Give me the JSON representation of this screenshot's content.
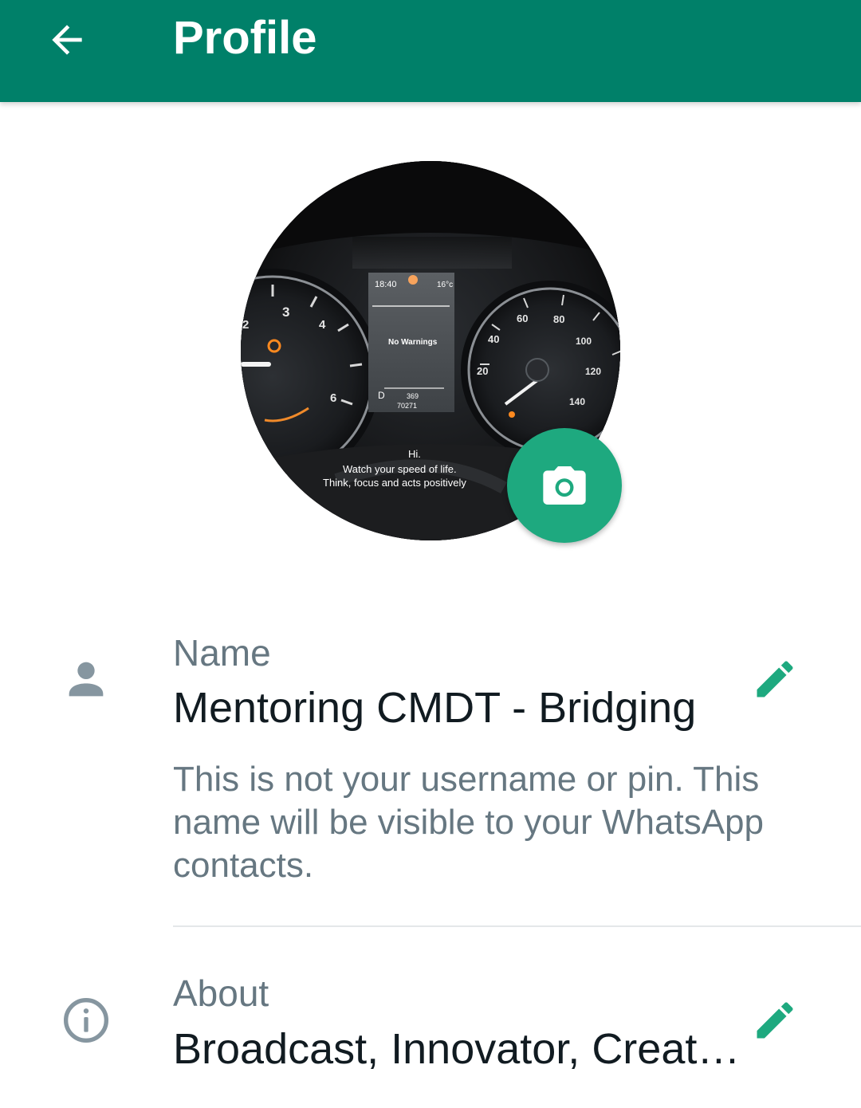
{
  "appbar": {
    "title": "Profile",
    "back_icon": "arrow-left-icon",
    "background": "#008069"
  },
  "avatar": {
    "clock": "18:40",
    "temperature": "16°c",
    "display_message": "No Warnings",
    "gear": "D",
    "range": "369",
    "odometer": "70271",
    "caption_line1": "Hi.",
    "caption_line2": "Watch your speed of life.",
    "caption_line3": "Think, focus and acts positively",
    "camera_icon": "camera-icon",
    "camera_button_color": "#1ea97f",
    "speedo_ticks": [
      "20",
      "40",
      "60",
      "80",
      "100",
      "120",
      "140"
    ],
    "tacho_ticks": [
      "2",
      "3",
      "4",
      "6"
    ]
  },
  "name_field": {
    "icon": "person-icon",
    "label": "Name",
    "value": "Mentoring CMDT - Bridging",
    "edit_icon": "pencil-icon",
    "hint": "This is not your username or pin. This name will be visible to your WhatsApp contacts."
  },
  "about_field": {
    "icon": "info-icon",
    "label": "About",
    "value": "Broadcast, Innovator, Creat…",
    "edit_icon": "pencil-icon"
  },
  "colors": {
    "accent": "#1ea97f",
    "secondary_text": "#667781",
    "primary_text": "#111b21"
  }
}
